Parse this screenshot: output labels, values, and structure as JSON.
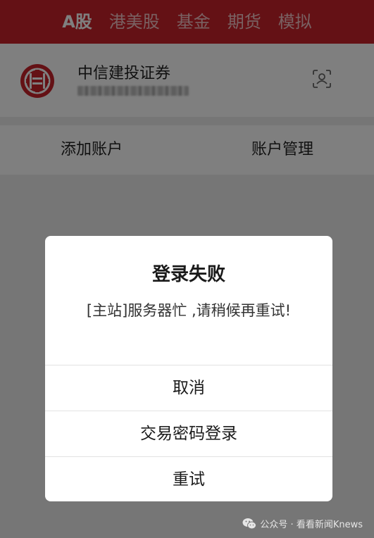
{
  "top_tabs": [
    {
      "label": "A股",
      "active": true
    },
    {
      "label": "港美股",
      "active": false
    },
    {
      "label": "基金",
      "active": false
    },
    {
      "label": "期货",
      "active": false
    },
    {
      "label": "模拟",
      "active": false
    }
  ],
  "broker": {
    "name": "中信建投证券",
    "account_masked": "████████",
    "logo_icon": "citic-logo-icon",
    "scan_icon": "face-scan-icon"
  },
  "actions": {
    "add_account": "添加账户",
    "manage_account": "账户管理"
  },
  "dialog": {
    "title": "登录失败",
    "message": "[主站]服务器忙 ,请稍候再重试!",
    "buttons": {
      "cancel": "取消",
      "password_login": "交易密码登录",
      "retry": "重试"
    }
  },
  "watermark": {
    "text": "公众号 · 看看新闻Knews",
    "icon": "wechat-icon"
  },
  "colors": {
    "brand_red": "#c9232b",
    "overlay": "rgba(0,0,0,0.5)"
  }
}
